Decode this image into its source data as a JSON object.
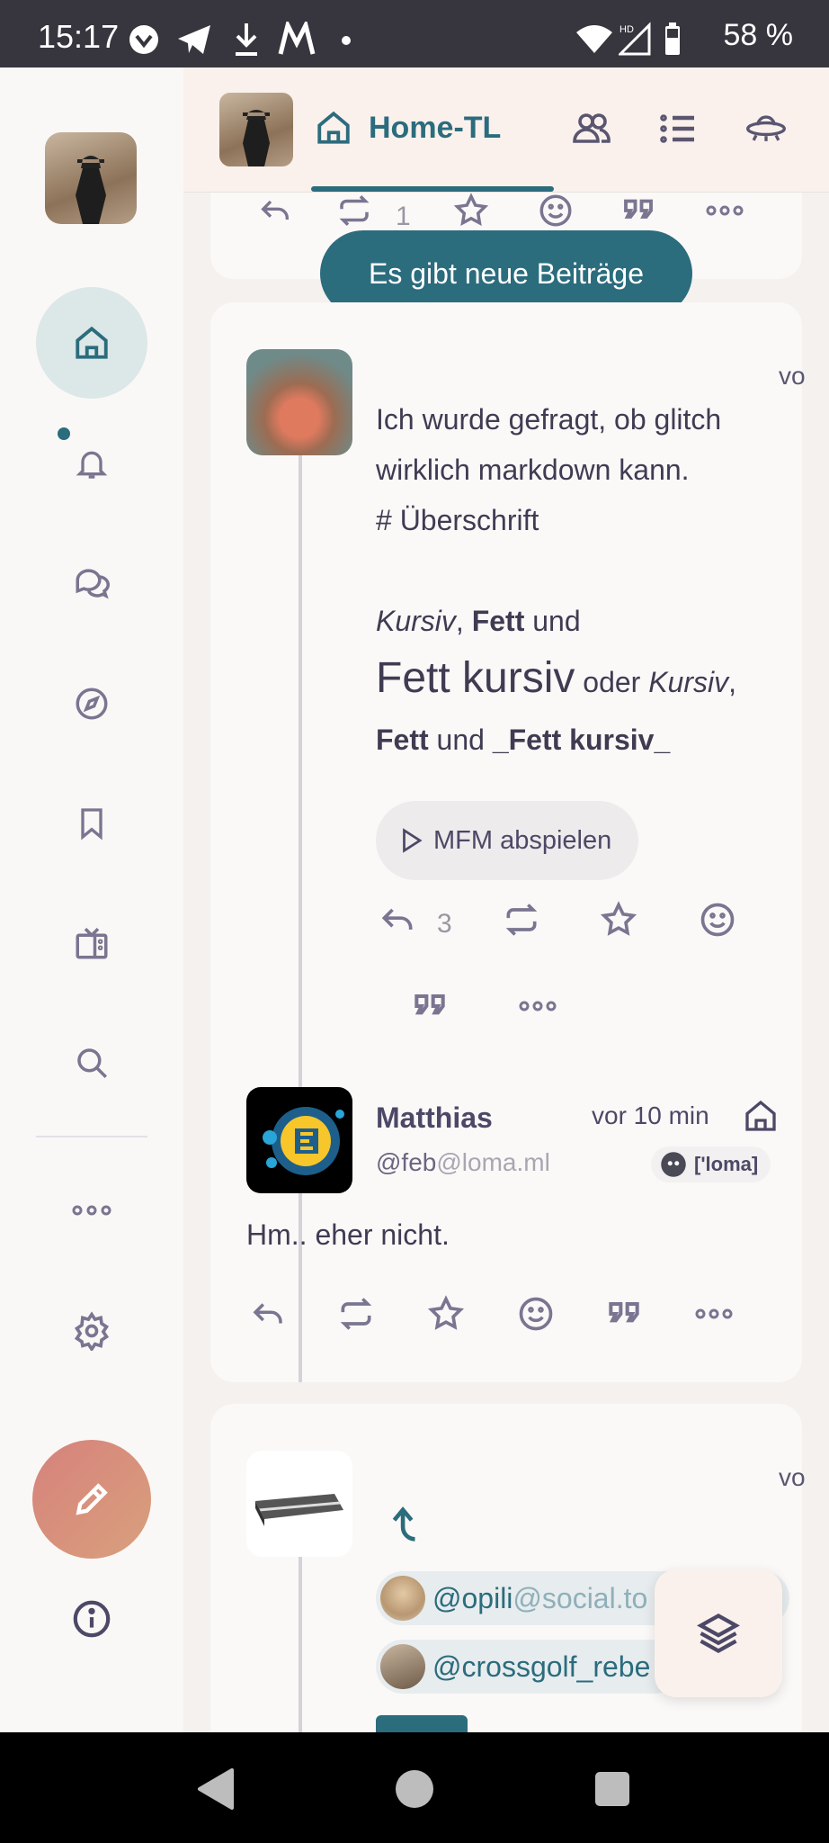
{
  "status_bar": {
    "time": "15:17",
    "battery": "58 %"
  },
  "sidebar": {
    "items": [
      "home-icon",
      "bell-icon",
      "chat-icon",
      "compass-icon",
      "bookmark-icon",
      "tv-icon",
      "search-icon",
      "more-icon",
      "gear-icon",
      "info-icon"
    ],
    "compose_icon": "pencil-icon"
  },
  "header": {
    "tab_home": "Home-TL",
    "icons": [
      "users-icon",
      "list-icon",
      "ufo-icon"
    ]
  },
  "new_posts_banner": "Es gibt neue Beiträge",
  "prev_note": {
    "renote_count": "1"
  },
  "note1": {
    "time_clip": "vo",
    "text_line1": "Ich wurde gefragt, ob glitch",
    "text_line2": "wirklich markdown kann.",
    "text_line3": "# Überschrift",
    "mfm_italic1": "Kursiv",
    "mfm_comma1": ", ",
    "mfm_bold1": "Fett",
    "mfm_und1": " und",
    "mfm_big": "Fett kursiv",
    "mfm_oder": " oder ",
    "mfm_italic2": "Kursiv",
    "mfm_comma2": ",",
    "mfm_bold2": "Fett",
    "mfm_und2": " und ",
    "mfm_bold3": "_Fett kursiv_",
    "mfm_play_label": "MFM abspielen",
    "reply_count": "3"
  },
  "reply": {
    "name": "Matthias",
    "handle_user": "@feb",
    "handle_host": "@loma.ml",
    "time": "vor 10 min",
    "instance": "['loma]",
    "text": "Hm.. eher nicht."
  },
  "note3": {
    "time_clip": "vo",
    "mention1_user": "@opili",
    "mention1_host": "@social.to",
    "mention2_user": "@crossgolf_rebe"
  },
  "colors": {
    "accent": "#2b6c7d",
    "compose_gradient_start": "#d6827c",
    "compose_gradient_end": "#d9a07c"
  }
}
